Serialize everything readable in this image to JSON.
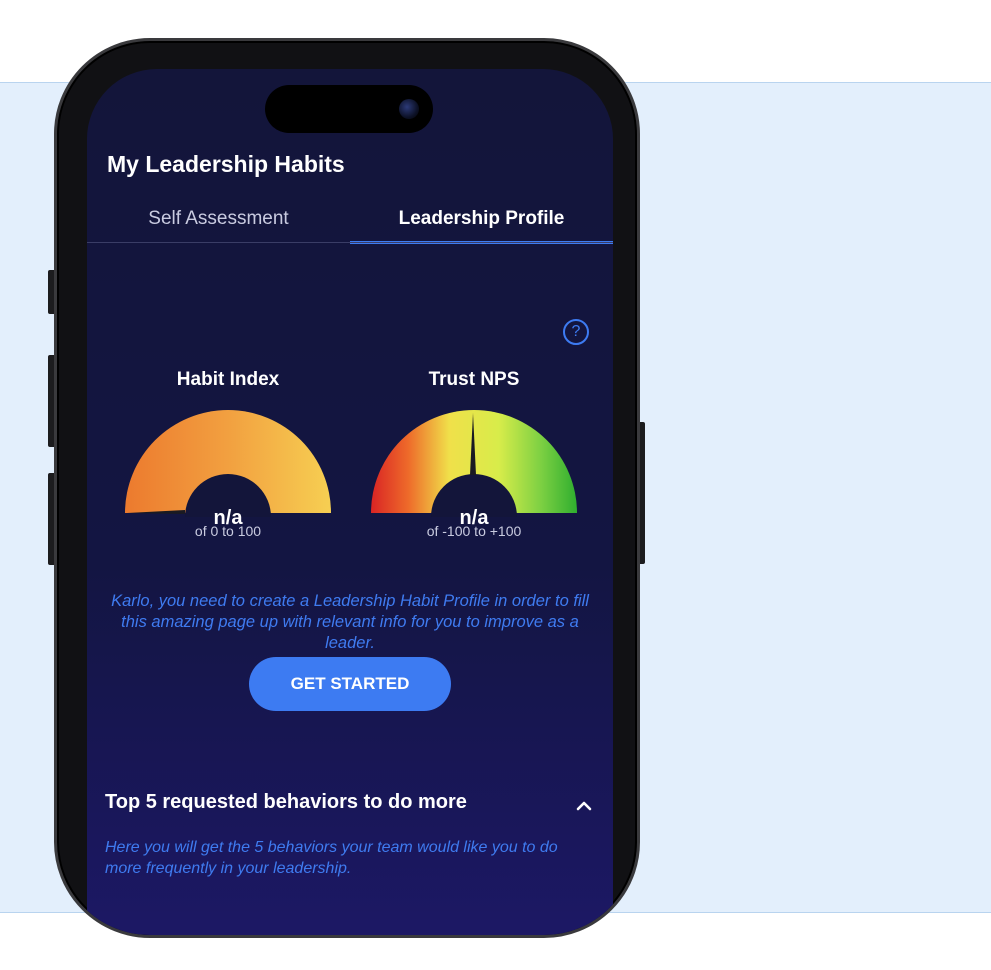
{
  "header": {
    "title": "My Leadership Habits"
  },
  "tabs": [
    {
      "label": "Self Assessment",
      "active": false
    },
    {
      "label": "Leadership Profile",
      "active": true
    }
  ],
  "help": {
    "icon": "help-icon",
    "glyph": "?"
  },
  "gauges": {
    "habit": {
      "title": "Habit Index",
      "value": "n/a",
      "scale": "of 0 to 100"
    },
    "nps": {
      "title": "Trust NPS",
      "value": "n/a",
      "scale": "of -100 to +100"
    }
  },
  "prompt": {
    "text": "Karlo, you need to create a Leadership Habit Profile in order to fill this amazing page up with relevant info for you to improve as a leader."
  },
  "cta": {
    "label": "GET STARTED"
  },
  "section": {
    "title": "Top 5 requested behaviors to do more",
    "description": "Here you will get the 5 behaviors your team would like you to do more frequently in your leadership.",
    "icon": "chevron-up-icon"
  },
  "colors": {
    "accent": "#3d7bf2",
    "background": "#13153a",
    "backdrop": "#e3effc"
  }
}
